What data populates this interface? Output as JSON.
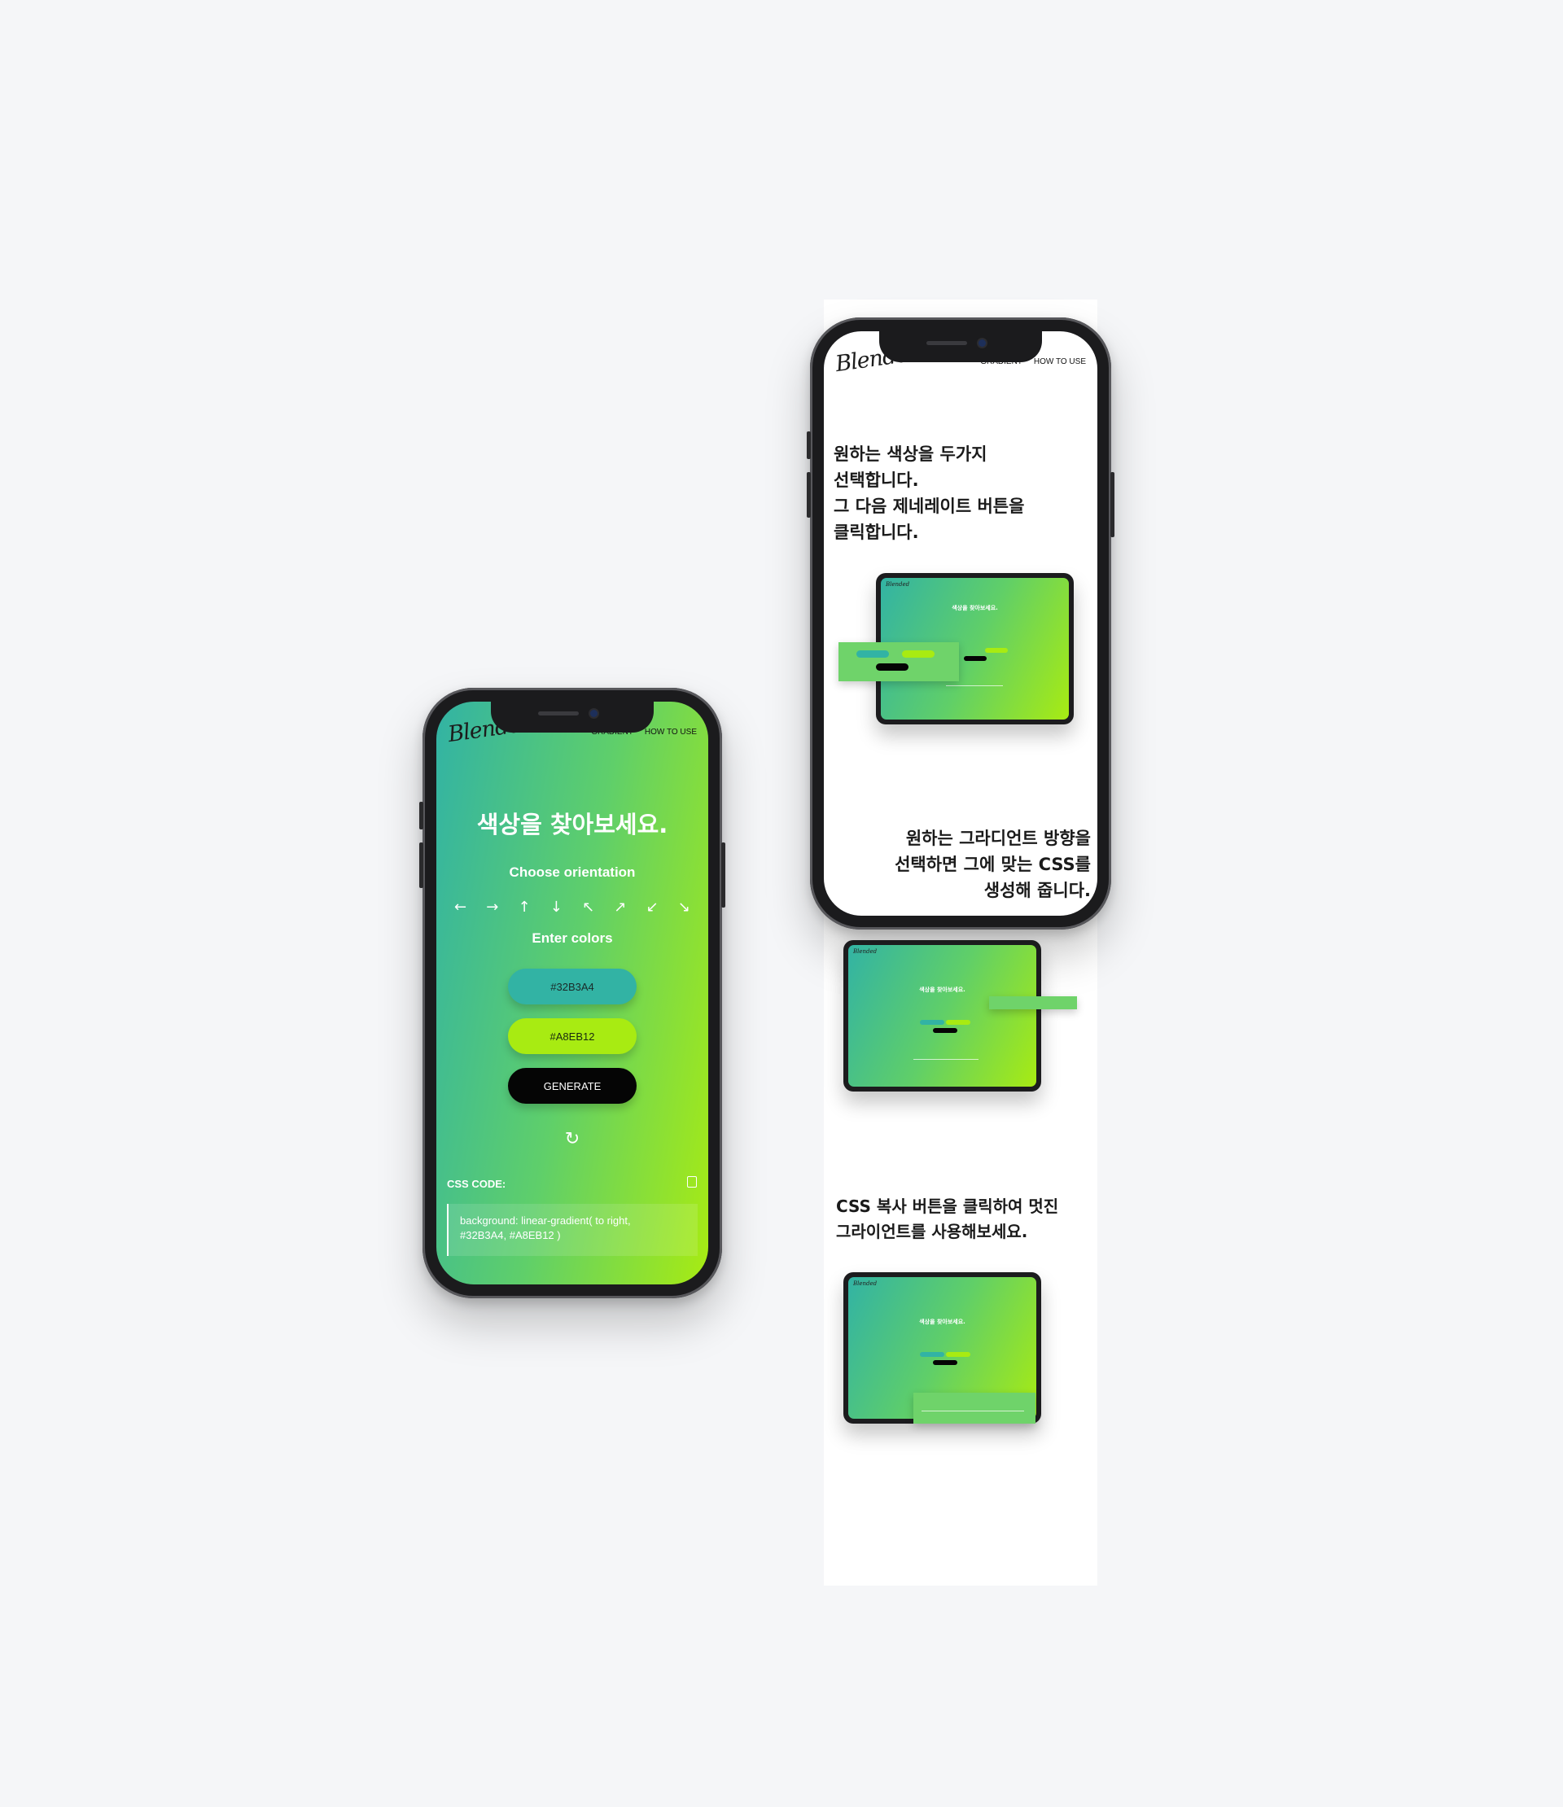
{
  "app": {
    "logo": "Blended",
    "nav": [
      "GRADIENT",
      "HOW TO USE"
    ]
  },
  "main_phone": {
    "title": "색상을 찾아보세요.",
    "orientation_label": "Choose orientation",
    "arrows": [
      "←",
      "→",
      "↑",
      "↓",
      "↖",
      "↗",
      "↙",
      "↘"
    ],
    "colors_label": "Enter colors",
    "color1": "#32B3A4",
    "color2": "#A8EB12",
    "generate_label": "GENERATE",
    "refresh_icon": "↻",
    "css_label": "CSS CODE:",
    "css_code_line1": "background: linear-gradient( to right,",
    "css_code_line2": "#32B3A4, #A8EB12 )"
  },
  "guide_phone": {
    "step1_line1": "원하는 색상을 두가지",
    "step1_line2": "선택합니다.",
    "step1_line3": "그 다음 제네레이트 버튼을",
    "step1_line4": "클릭합니다.",
    "step2_line1": "원하는 그라디언트 방향을",
    "step2_line2": "선택하면 그에 맞는 CSS를",
    "step2_line3": "생성해 줍니다."
  },
  "strip": {
    "step3_line1": "CSS 복사 버튼을 클릭하여 멋진",
    "step3_line2": "그라이언트를 사용해보세요."
  },
  "colors": {
    "gradient_start": "#32B3A4",
    "gradient_end": "#A8EB12",
    "button_dark": "#050505"
  }
}
